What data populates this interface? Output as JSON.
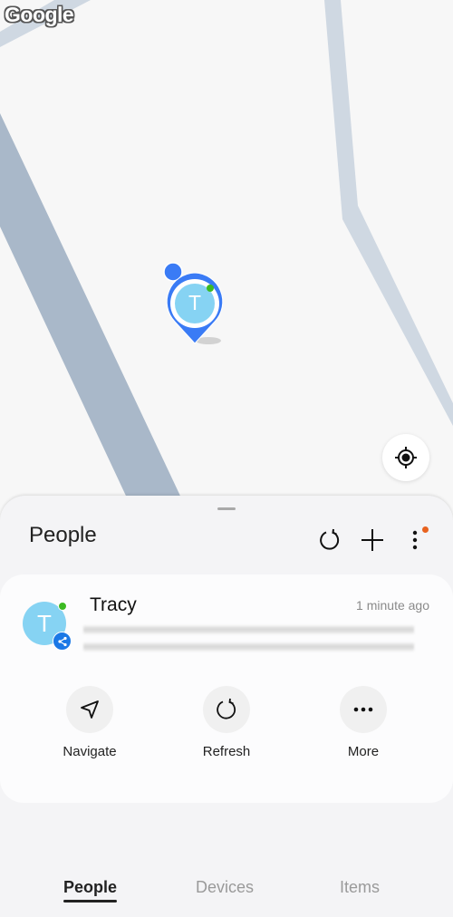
{
  "map": {
    "provider_logo": "Google",
    "marker": {
      "initial": "T",
      "online_color": "#3cba22",
      "accent": "#3a7bf5"
    },
    "locate_button": {
      "icon": "my-location-icon"
    }
  },
  "sheet": {
    "title": "People",
    "header_actions": [
      {
        "name": "refresh",
        "icon": "refresh-icon"
      },
      {
        "name": "add",
        "icon": "plus-icon"
      },
      {
        "name": "more-options",
        "icon": "more-vertical-icon",
        "has_badge": true,
        "badge_color": "#e8621f"
      }
    ],
    "person": {
      "name": "Tracy",
      "initial": "T",
      "last_seen": "1 minute ago",
      "online": true,
      "shared": true,
      "address_redacted": true
    },
    "actions": [
      {
        "label": "Navigate",
        "icon": "navigate-icon"
      },
      {
        "label": "Refresh",
        "icon": "refresh-icon"
      },
      {
        "label": "More",
        "icon": "more-horizontal-icon"
      }
    ]
  },
  "tabs": [
    {
      "label": "People",
      "active": true
    },
    {
      "label": "Devices",
      "active": false
    },
    {
      "label": "Items",
      "active": false
    }
  ]
}
